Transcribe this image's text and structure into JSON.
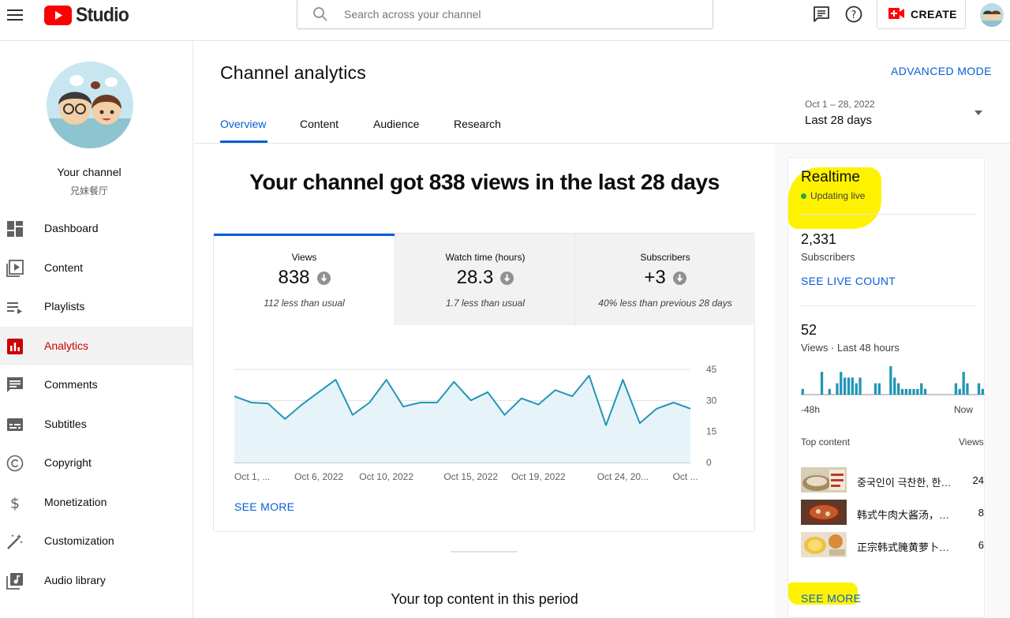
{
  "app": {
    "logo_text": "Studio",
    "search_placeholder": "Search across your channel",
    "create_label": "CREATE"
  },
  "sidebar": {
    "channel_title": "Your channel",
    "channel_name": "兄妹餐厅",
    "items": [
      {
        "label": "Dashboard",
        "icon": "dashboard-icon"
      },
      {
        "label": "Content",
        "icon": "content-icon"
      },
      {
        "label": "Playlists",
        "icon": "playlists-icon"
      },
      {
        "label": "Analytics",
        "icon": "analytics-icon",
        "active": true
      },
      {
        "label": "Comments",
        "icon": "comments-icon"
      },
      {
        "label": "Subtitles",
        "icon": "subtitles-icon"
      },
      {
        "label": "Copyright",
        "icon": "copyright-icon"
      },
      {
        "label": "Monetization",
        "icon": "monetization-icon"
      },
      {
        "label": "Customization",
        "icon": "customization-icon"
      },
      {
        "label": "Audio library",
        "icon": "audio-library-icon"
      }
    ]
  },
  "header": {
    "title": "Channel analytics",
    "advanced_mode": "ADVANCED MODE",
    "tabs": [
      "Overview",
      "Content",
      "Audience",
      "Research"
    ],
    "active_tab": "Overview",
    "date_range": "Oct 1 – 28, 2022",
    "date_label": "Last 28 days"
  },
  "overview": {
    "headline": "Your channel got 838 views in the last 28 days",
    "metrics": [
      {
        "label": "Views",
        "value": "838",
        "delta": "112 less than usual"
      },
      {
        "label": "Watch time (hours)",
        "value": "28.3",
        "delta": "1.7 less than usual"
      },
      {
        "label": "Subscribers",
        "value": "+3",
        "delta": "40% less than previous 28 days"
      }
    ],
    "see_more": "SEE MORE",
    "top_content_title": "Your top content in this period"
  },
  "chart_data": {
    "type": "line",
    "title": "",
    "xlabel": "",
    "ylabel": "",
    "ylim": [
      0,
      45
    ],
    "yticks": [
      0,
      15,
      30,
      45
    ],
    "xtick_labels": [
      "Oct 1, ...",
      "Oct 6, 2022",
      "Oct 10, 2022",
      "Oct 15, 2022",
      "Oct 19, 2022",
      "Oct 24, 20...",
      "Oct ..."
    ],
    "xtick_days": [
      1,
      6,
      10,
      15,
      19,
      24,
      27.7
    ],
    "x": [
      1,
      2,
      3,
      4,
      5,
      6,
      7,
      8,
      9,
      10,
      11,
      12,
      13,
      14,
      15,
      16,
      17,
      18,
      19,
      20,
      21,
      22,
      23,
      24,
      25,
      26,
      27,
      28
    ],
    "series": [
      {
        "values": [
          32,
          29,
          28.5,
          21,
          28,
          34,
          40,
          23,
          29,
          40,
          27,
          29,
          29,
          39,
          30,
          34,
          23,
          31,
          28,
          35,
          32,
          42,
          18,
          40,
          19,
          26,
          29,
          26
        ]
      }
    ],
    "color": "#2196b6",
    "fill": "#e6f4fa"
  },
  "realtime": {
    "title": "Realtime",
    "status": "Updating live",
    "subscribers_value": "2,331",
    "subscribers_label": "Subscribers",
    "see_live": "SEE LIVE COUNT",
    "views_value": "52",
    "views_label": "Views · Last 48 hours",
    "hourly_views": [
      1,
      0,
      0,
      0,
      0,
      4,
      0,
      1,
      0,
      2,
      4,
      3,
      3,
      3,
      2,
      3,
      0,
      0,
      0,
      2,
      2,
      0,
      0,
      5,
      3,
      2,
      1,
      1,
      1,
      1,
      1,
      2,
      1,
      0,
      0,
      0,
      0,
      0,
      0,
      0,
      2,
      1,
      4,
      2,
      0,
      0,
      2,
      1
    ],
    "axis_left": "-48h",
    "axis_right": "Now",
    "top_content_label": "Top content",
    "views_col_label": "Views",
    "top_content": [
      {
        "title": "중국인이 극찬한, 한국식 소고기무국",
        "views": "24"
      },
      {
        "title": "韩式牛肉大酱汤，家常做法",
        "views": "8"
      },
      {
        "title": "正宗韩式腌黄萝卜，超简单",
        "views": "6"
      }
    ],
    "see_more": "SEE MORE"
  },
  "colors": {
    "accent": "#065fd4",
    "brand_red": "#ff0000",
    "active_nav": "#cc0000",
    "highlight": "#fff200",
    "live": "#2ba640"
  }
}
